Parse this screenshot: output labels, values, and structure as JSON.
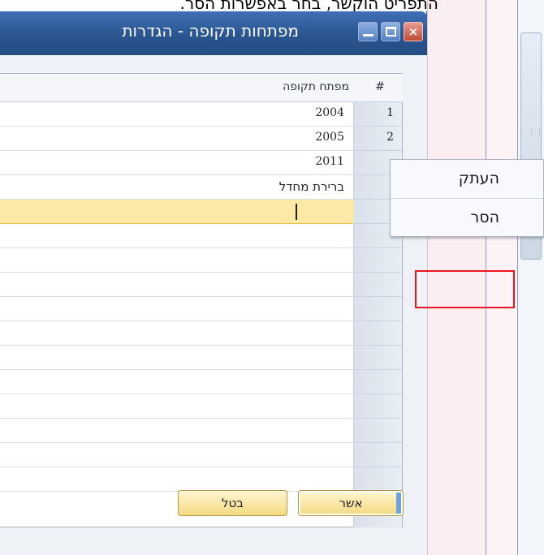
{
  "caption": "התפריט הוקשר, בחר באפשרות הסר.",
  "window": {
    "title": "מפתחות תקופה - הגדרות",
    "close_glyph": "×"
  },
  "grid": {
    "header_number": "#",
    "header_key": "מפתח תקופה",
    "rows": [
      {
        "number": "1",
        "key": "2004"
      },
      {
        "number": "2",
        "key": "2005"
      },
      {
        "number": "",
        "key": "2011"
      },
      {
        "number": "",
        "key": "ברירת מחדל"
      },
      {
        "number": "",
        "key": ""
      }
    ]
  },
  "buttons": {
    "ok": "אשר",
    "cancel": "בטל"
  },
  "context_menu": {
    "items": [
      {
        "label": "העתק"
      },
      {
        "label": "הסר"
      }
    ]
  },
  "colors": {
    "titlebar": "#2a558f",
    "active_row": "#fde9a6",
    "highlight_box": "#e8161f"
  }
}
